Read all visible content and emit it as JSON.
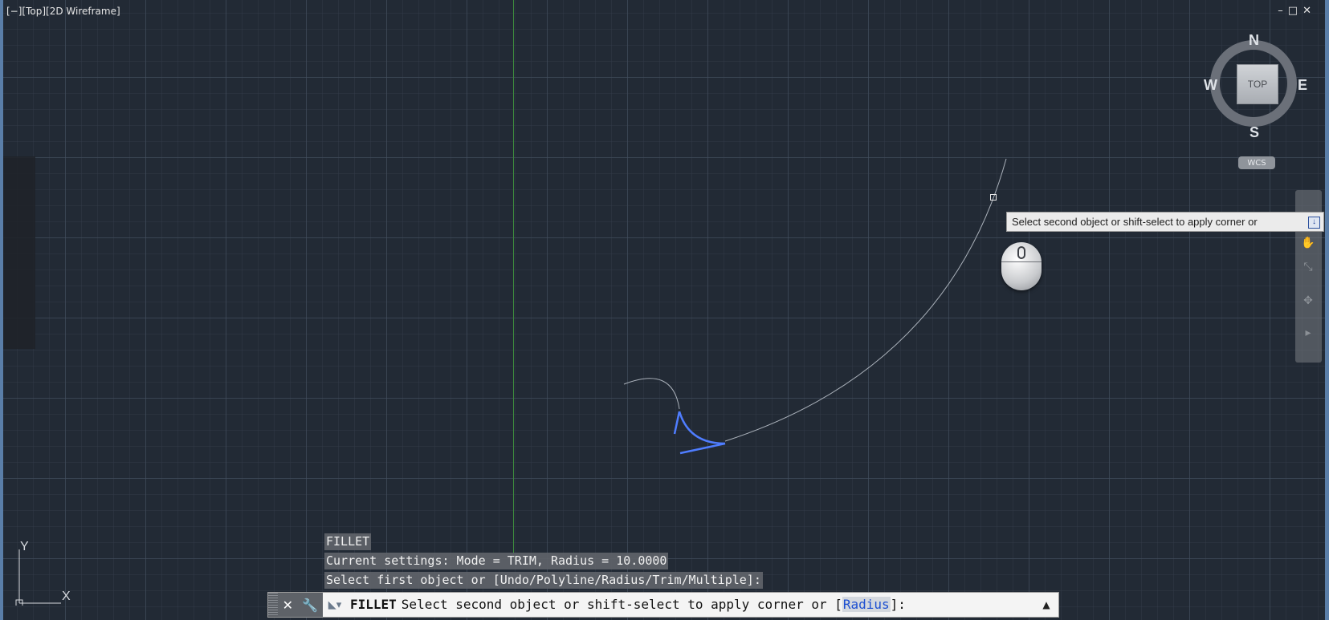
{
  "viewport": {
    "label": "[−][Top][2D Wireframe]",
    "window_controls": [
      "–",
      "□",
      "✕"
    ]
  },
  "viewcube": {
    "north": "N",
    "south": "S",
    "east": "E",
    "west": "W",
    "face": "TOP",
    "wcs": "WCS"
  },
  "tooltip": {
    "text": "Select second object or shift-select to apply corner or"
  },
  "ucs": {
    "x_label": "X",
    "y_label": "Y"
  },
  "command_history": [
    "FILLET",
    "Current settings: Mode = TRIM, Radius = 10.0000",
    "Select first object or [Undo/Polyline/Radius/Trim/Multiple]:"
  ],
  "command_line": {
    "close_icon": "✕",
    "customize_icon": "🔧",
    "command_name": "FILLET",
    "prompt_before": "Select second object or shift-select to apply corner or [",
    "option": "Radius",
    "prompt_after": "]:",
    "expand_icon": "▲"
  },
  "colors": {
    "background": "#222a35",
    "highlight": "#4f7dff",
    "y_axis": "#3d8a3d"
  }
}
